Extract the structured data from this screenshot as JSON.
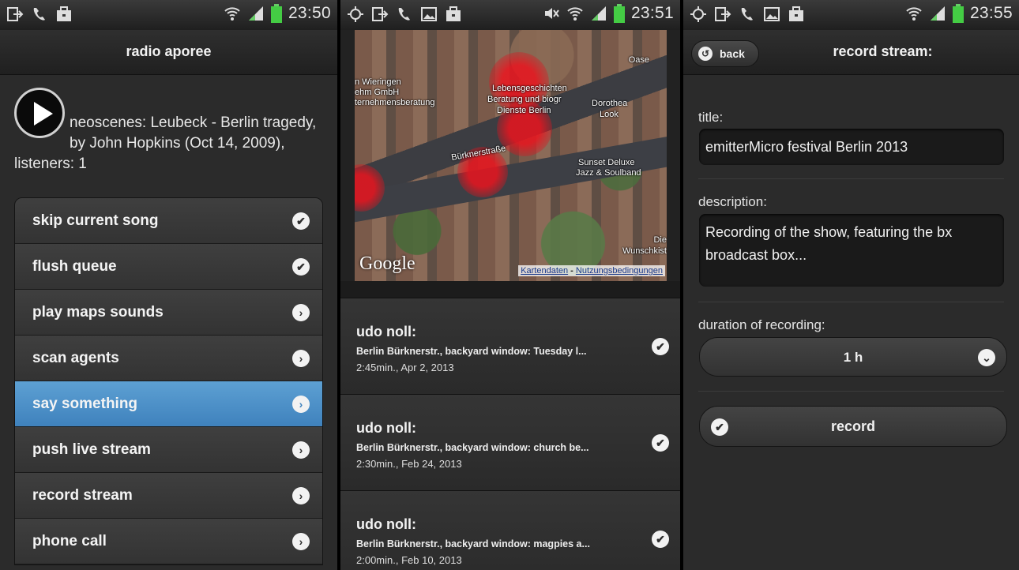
{
  "screen1": {
    "status": {
      "time": "23:50"
    },
    "title": "radio aporee",
    "now_playing": "neoscenes: Leubeck - Berlin tragedy, by John Hopkins (Oct 14, 2009), listeners: 1",
    "menu": [
      {
        "label": "skip current song",
        "icon": "check-icon"
      },
      {
        "label": "flush queue",
        "icon": "check-icon"
      },
      {
        "label": "play maps sounds",
        "icon": "chevron-right-icon"
      },
      {
        "label": "scan agents",
        "icon": "chevron-right-icon"
      },
      {
        "label": "say something",
        "icon": "chevron-right-icon"
      },
      {
        "label": "push live stream",
        "icon": "chevron-right-icon"
      },
      {
        "label": "record stream",
        "icon": "chevron-right-icon"
      },
      {
        "label": "phone call",
        "icon": "chevron-right-icon"
      }
    ],
    "active_item": "say something",
    "accent": "#4a8fc8"
  },
  "screen2": {
    "status": {
      "time": "23:51"
    },
    "map": {
      "labels": {
        "oase": "Oase",
        "wieringen": "n Wieringen",
        "gmbh": "ehm GmbH",
        "beratung": "ternehmensberatung",
        "lebens1": "Lebensgeschichten",
        "lebens2": "Beratung und biogr",
        "lebens3": "Dienste Berlin",
        "dorothea1": "Dorothea",
        "dorothea2": "Look",
        "street": "Bürknerstraße",
        "sunset1": "Sunset Deluxe",
        "sunset2": "Jazz & Soulband",
        "die": "Die",
        "wunsch": "Wunschkist"
      },
      "logo": "Google",
      "link1": "Kartendaten",
      "link_sep": " - ",
      "link2": "Nutzungsbedingungen"
    },
    "tracks": [
      {
        "author": "udo noll:",
        "description": "Berlin Bürknerstr., backyard window: Tuesday l...",
        "meta": "2:45min., Apr 2, 2013"
      },
      {
        "author": "udo noll:",
        "description": "Berlin Bürknerstr., backyard window: church be...",
        "meta": "2:30min., Feb 24, 2013"
      },
      {
        "author": "udo noll:",
        "description": "Berlin Bürknerstr., backyard window: magpies a...",
        "meta": "2:00min., Feb 10, 2013"
      }
    ]
  },
  "screen3": {
    "status": {
      "time": "23:55"
    },
    "back_label": "back",
    "title": "record stream:",
    "title_label": "title:",
    "title_value": "emitterMicro festival Berlin 2013",
    "description_label": "description:",
    "description_value": "Recording of the show, featuring the bx broadcast box...",
    "duration_label": "duration of recording:",
    "duration_value": "1 h",
    "record_label": "record"
  }
}
